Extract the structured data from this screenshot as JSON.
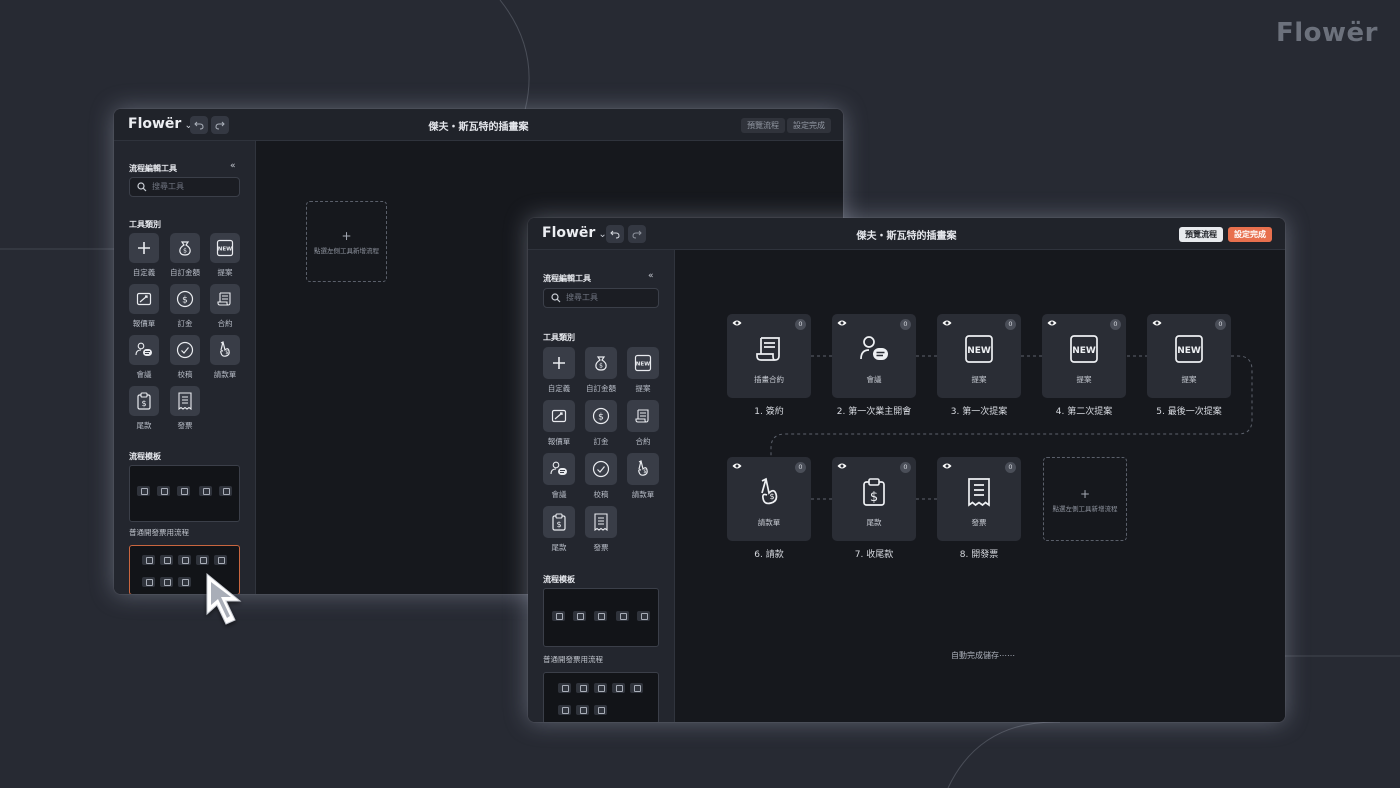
{
  "brand": "Flowër",
  "app": {
    "logo": "Flowër",
    "title": "傑夫・斯瓦特的插畫案",
    "preview_label": "預覽流程",
    "done_label": "設定完成"
  },
  "sidebar": {
    "heading": "流程編輯工具",
    "search_placeholder": "搜尋工具",
    "tools_heading": "工具類別",
    "tools": [
      {
        "label": "自定義",
        "icon": "plus-icon"
      },
      {
        "label": "自訂金額",
        "icon": "money-bag-icon"
      },
      {
        "label": "提案",
        "icon": "new-badge-icon"
      },
      {
        "label": "報價單",
        "icon": "quote-icon"
      },
      {
        "label": "訂金",
        "icon": "dollar-coin-icon"
      },
      {
        "label": "合約",
        "icon": "contract-scroll-icon"
      },
      {
        "label": "會議",
        "icon": "meeting-icon"
      },
      {
        "label": "校稿",
        "icon": "check-circle-icon"
      },
      {
        "label": "請款單",
        "icon": "invoice-request-icon"
      },
      {
        "label": "尾款",
        "icon": "final-payment-icon"
      },
      {
        "label": "發票",
        "icon": "receipt-icon"
      }
    ],
    "templates_heading": "流程模板",
    "template_name": "普通開發票用流程"
  },
  "canvas_a": {
    "placeholder": "點選左側工具新增流程"
  },
  "flow": {
    "nodes": [
      {
        "title": "插畫合約",
        "step": "1. 簽約",
        "count": "0",
        "icon": "contract-scroll-icon"
      },
      {
        "title": "會議",
        "step": "2. 第一次業主開會",
        "count": "0",
        "icon": "meeting-icon"
      },
      {
        "title": "提案",
        "step": "3. 第一次提案",
        "count": "0",
        "icon": "new-badge-icon"
      },
      {
        "title": "提案",
        "step": "4. 第二次提案",
        "count": "0",
        "icon": "new-badge-icon"
      },
      {
        "title": "提案",
        "step": "5. 最後一次提案",
        "count": "0",
        "icon": "new-badge-icon"
      },
      {
        "title": "請款單",
        "step": "6. 請款",
        "count": "0",
        "icon": "invoice-request-icon"
      },
      {
        "title": "尾款",
        "step": "7. 收尾款",
        "count": "0",
        "icon": "final-payment-icon"
      },
      {
        "title": "發票",
        "step": "8. 開發票",
        "count": "0",
        "icon": "receipt-icon"
      }
    ],
    "add_placeholder": "點選左側工具新增流程",
    "autosave": "自動完成儲存⋯⋯"
  },
  "colors": {
    "background": "#272a33",
    "accent": "#e8704e",
    "window": "#16181d",
    "sidebar": "#23262e"
  }
}
